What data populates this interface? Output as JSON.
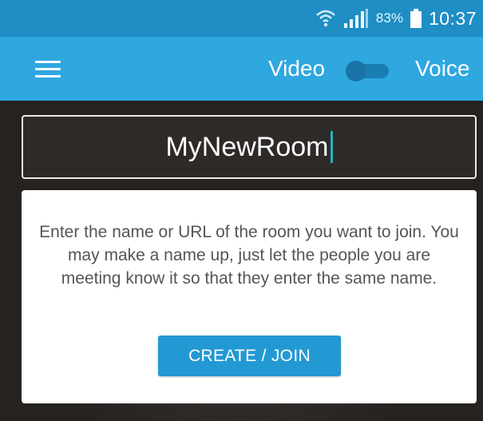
{
  "status_bar": {
    "battery_percent": "83%",
    "time": "10:37",
    "icons": [
      "wifi-icon",
      "signal-icon",
      "battery-icon"
    ]
  },
  "app_bar": {
    "menu_icon": "hamburger-menu-icon",
    "video_label": "Video",
    "voice_label": "Voice",
    "toggle_state": "video"
  },
  "room_input": {
    "value": "MyNewRoom"
  },
  "card": {
    "instructions": "Enter the name or URL of the room you want to join. You may make a name up, just let the people you are meeting know it so that they enter the same name.",
    "button_label": "CREATE / JOIN"
  },
  "colors": {
    "status_bar_bg": "#1e8ec5",
    "app_bar_bg": "#2fa7df",
    "button_bg": "#2399d3",
    "caret": "#1fb6c2"
  }
}
